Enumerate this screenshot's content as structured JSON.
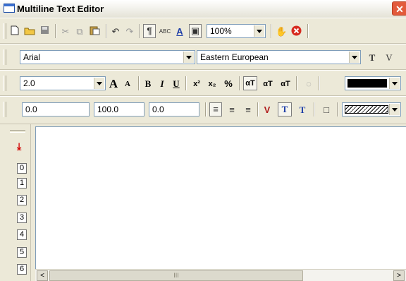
{
  "window": {
    "title": "Multiline Text Editor",
    "close_glyph": "✕"
  },
  "toolbar1": {
    "zoom_value": "100%",
    "icons": [
      "new-document-icon",
      "open-folder-icon",
      "save-icon",
      "cut-icon",
      "copy-icon",
      "paste-icon",
      "undo-icon",
      "redo-icon",
      "paragraph-icon",
      "spellcheck-icon",
      "text-style-icon",
      "frame-icon",
      "hand-icon",
      "cancel-icon"
    ]
  },
  "toolbar2": {
    "font_name": "Arial",
    "script_name": "Eastern European",
    "glyph_t": "T",
    "glyph_v": "V"
  },
  "toolbar3": {
    "size_value": "2.0",
    "bold": "B",
    "italic": "I",
    "underline": "U",
    "superscript": "x²",
    "subscript": "x₂",
    "fraction": "%",
    "color_value": "#000000"
  },
  "toolbar4": {
    "field1": "0.0",
    "field2": "100.0",
    "field3": "0.0"
  },
  "line_buttons": [
    "0",
    "1",
    "2",
    "3",
    "4",
    "5",
    "6"
  ],
  "scroll": {
    "left": "<",
    "right": ">",
    "thumb": "III"
  }
}
